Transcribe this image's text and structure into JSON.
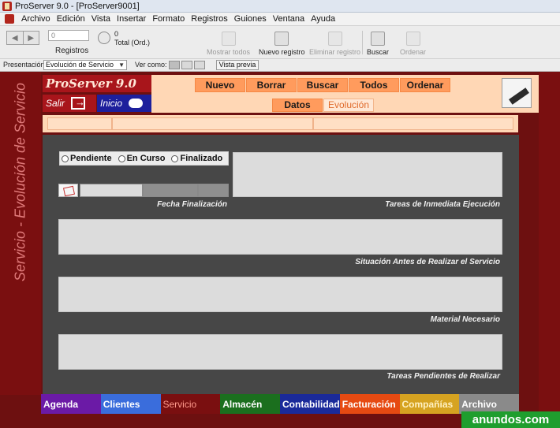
{
  "window": {
    "title": "ProServer 9.0 - [ProServer9001]"
  },
  "menu": {
    "items": [
      "Archivo",
      "Edición",
      "Vista",
      "Insertar",
      "Formato",
      "Registros",
      "Guiones",
      "Ventana",
      "Ayuda"
    ]
  },
  "toolbar": {
    "records_value": "0",
    "records_label": "Registros",
    "total_value": "0",
    "total_label": "Total (Ord.)",
    "buttons": [
      {
        "label": "Mostrar todos",
        "icon": "show-all-icon",
        "enabled": false
      },
      {
        "label": "Nuevo registro",
        "icon": "new-record-icon",
        "enabled": true
      },
      {
        "label": "Eliminar registro",
        "icon": "delete-record-icon",
        "enabled": false
      },
      {
        "label": "Buscar",
        "icon": "search-icon",
        "enabled": true
      },
      {
        "label": "Ordenar",
        "icon": "sort-icon",
        "enabled": false
      }
    ]
  },
  "layout_bar": {
    "presentation_label": "Presentación:",
    "presentation_value": "Evolución de Servicio",
    "view_as_label": "Ver como:",
    "preview_label": "Vista previa"
  },
  "form": {
    "vertical_title": "Servicio - Evolución de Servicio",
    "logo_text": "ProServer 9.0",
    "salir_label": "Salir",
    "inicio_label": "Inicio",
    "header_buttons": [
      "Nuevo",
      "Borrar",
      "Buscar",
      "Todos",
      "Ordenar"
    ],
    "tabs": [
      "Datos",
      "Evolución"
    ],
    "status_options": [
      "Pendiente",
      "En Curso",
      "Finalizado"
    ],
    "labels": {
      "fecha_finalizacion": "Fecha Finalización",
      "tareas_inmediatas": "Tareas de Inmediata Ejecución",
      "situacion_antes": "Situación Antes de Realizar el Servicio",
      "material_necesario": "Material Necesario",
      "tareas_pendientes": "Tareas Pendientes de Realizar"
    }
  },
  "bottom_tabs": [
    "Agenda",
    "Clientes",
    "Servicio",
    "Almacén",
    "Contabilidad",
    "Facturación",
    "Compañías",
    "Archivo"
  ],
  "watermark": "anundos.com",
  "colors": {
    "maroon": "#7a0f10",
    "peach": "#ffd7b5",
    "orange_button": "#ff9b5d",
    "panel_gray": "#474747",
    "field_gray": "#dcdcdc"
  }
}
